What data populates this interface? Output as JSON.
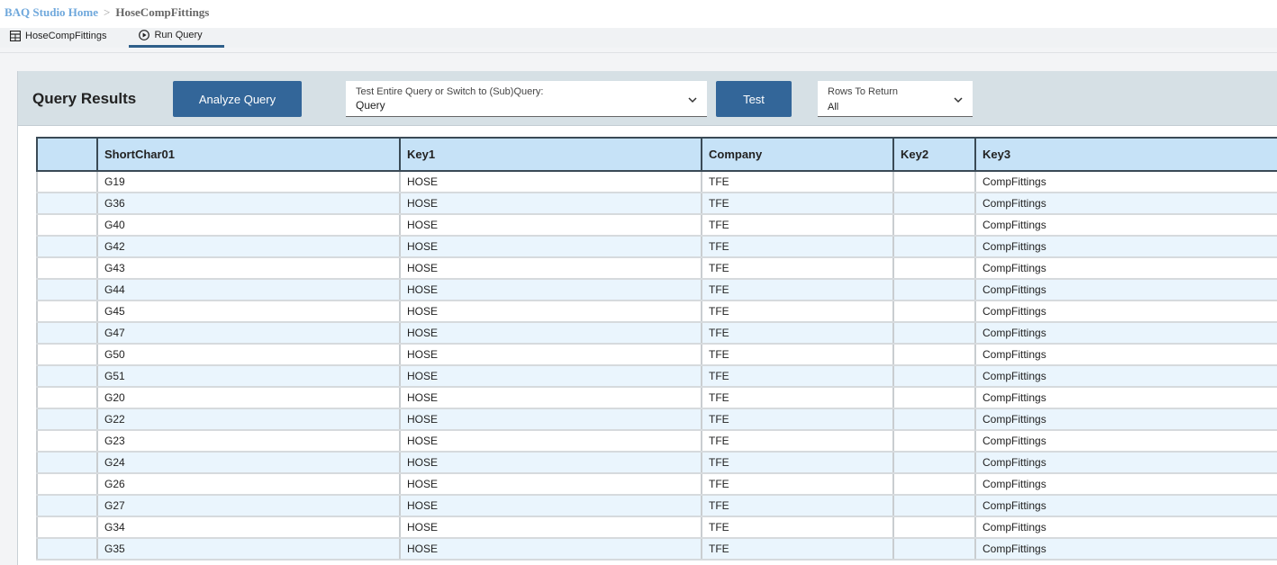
{
  "breadcrumb": {
    "home": "BAQ Studio Home",
    "separator": ">",
    "current": "HoseCompFittings"
  },
  "tabs": [
    {
      "label": "HoseCompFittings",
      "icon": "grid-icon"
    },
    {
      "label": "Run Query",
      "icon": "play-circle-icon"
    }
  ],
  "panel": {
    "title": "Query Results",
    "analyze_label": "Analyze Query",
    "query_dropdown": {
      "label": "Test Entire Query or Switch to (Sub)Query:",
      "value": "Query"
    },
    "test_label": "Test",
    "rows_dropdown": {
      "label": "Rows To Return",
      "value": "All"
    }
  },
  "table": {
    "columns": [
      "",
      "ShortChar01",
      "Key1",
      "Company",
      "Key2",
      "Key3"
    ],
    "rows": [
      [
        "",
        "G19",
        "HOSE",
        "TFE",
        "",
        "CompFittings"
      ],
      [
        "",
        "G36",
        "HOSE",
        "TFE",
        "",
        "CompFittings"
      ],
      [
        "",
        "G40",
        "HOSE",
        "TFE",
        "",
        "CompFittings"
      ],
      [
        "",
        "G42",
        "HOSE",
        "TFE",
        "",
        "CompFittings"
      ],
      [
        "",
        "G43",
        "HOSE",
        "TFE",
        "",
        "CompFittings"
      ],
      [
        "",
        "G44",
        "HOSE",
        "TFE",
        "",
        "CompFittings"
      ],
      [
        "",
        "G45",
        "HOSE",
        "TFE",
        "",
        "CompFittings"
      ],
      [
        "",
        "G47",
        "HOSE",
        "TFE",
        "",
        "CompFittings"
      ],
      [
        "",
        "G50",
        "HOSE",
        "TFE",
        "",
        "CompFittings"
      ],
      [
        "",
        "G51",
        "HOSE",
        "TFE",
        "",
        "CompFittings"
      ],
      [
        "",
        "G20",
        "HOSE",
        "TFE",
        "",
        "CompFittings"
      ],
      [
        "",
        "G22",
        "HOSE",
        "TFE",
        "",
        "CompFittings"
      ],
      [
        "",
        "G23",
        "HOSE",
        "TFE",
        "",
        "CompFittings"
      ],
      [
        "",
        "G24",
        "HOSE",
        "TFE",
        "",
        "CompFittings"
      ],
      [
        "",
        "G26",
        "HOSE",
        "TFE",
        "",
        "CompFittings"
      ],
      [
        "",
        "G27",
        "HOSE",
        "TFE",
        "",
        "CompFittings"
      ],
      [
        "",
        "G34",
        "HOSE",
        "TFE",
        "",
        "CompFittings"
      ],
      [
        "",
        "G35",
        "HOSE",
        "TFE",
        "",
        "CompFittings"
      ]
    ]
  },
  "colors": {
    "accent": "#336699",
    "header_bg": "#c6e2f7",
    "alt_row": "#eaf5fd",
    "link": "#6fa8dc"
  }
}
